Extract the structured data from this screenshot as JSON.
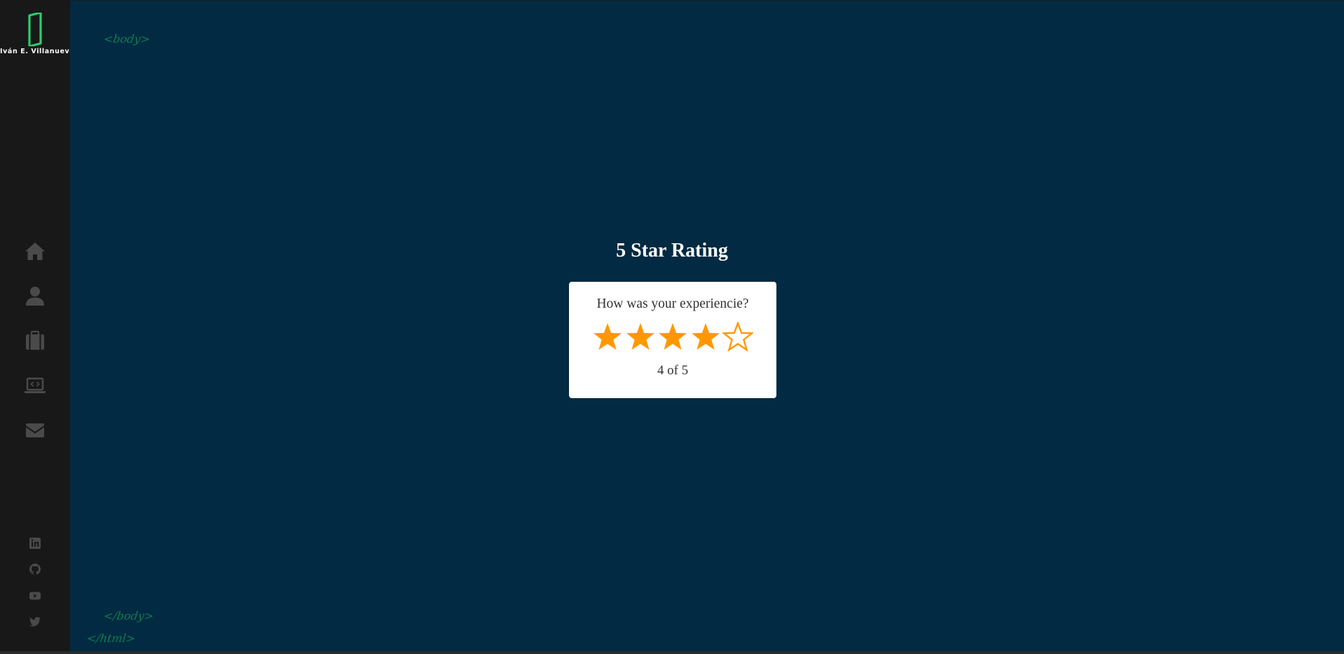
{
  "brand": {
    "name": "Iván E. Villanueva",
    "logo_icon": "door-logo-icon",
    "logo_color": "#2ecc71"
  },
  "sidebar": {
    "nav_items": [
      {
        "icon": "home-icon"
      },
      {
        "icon": "user-icon"
      },
      {
        "icon": "briefcase-icon"
      },
      {
        "icon": "laptop-code-icon"
      },
      {
        "icon": "envelope-icon"
      }
    ],
    "social_links": [
      {
        "icon": "linkedin-icon"
      },
      {
        "icon": "github-icon"
      },
      {
        "icon": "youtube-icon"
      },
      {
        "icon": "twitter-icon"
      }
    ],
    "icon_color": "#4a4a4a"
  },
  "decorations": {
    "body_open": "<body>",
    "body_close": "</body>",
    "html_close": "</html>"
  },
  "main": {
    "title": "5 Star Rating",
    "question": "How was your experiencie?",
    "rating": {
      "value": 4,
      "max": 5,
      "label": "4 of 5"
    },
    "star_color": "#ff9800",
    "background": "#022a42"
  }
}
